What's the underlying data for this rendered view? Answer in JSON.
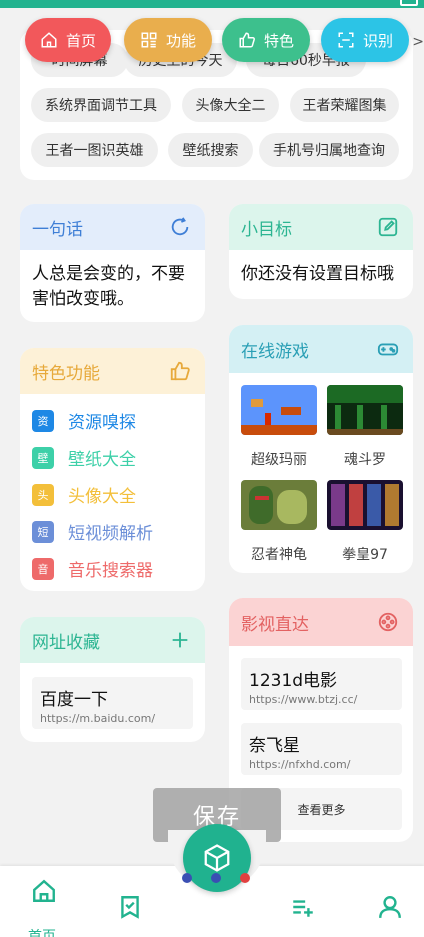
{
  "colors": {
    "accent": "#22b38f",
    "home_pill": "#f2585b",
    "func_pill": "#e9ae4d",
    "feat_pill": "#3dc08d",
    "scan_pill": "#2cc4e6"
  },
  "top_tabs": [
    {
      "label": "首页",
      "icon": "home-icon"
    },
    {
      "label": "功能",
      "icon": "grid-icon"
    },
    {
      "label": "特色",
      "icon": "thumbs-up-icon"
    },
    {
      "label": "识别",
      "icon": "scan-icon"
    }
  ],
  "edge_arrow": ">",
  "tags": {
    "row0": [
      "时间屏幕",
      "历史上的今天",
      "每日60秒早报"
    ],
    "row1": [
      "系统界面调节工具",
      "头像大全二",
      "王者荣耀图集"
    ],
    "row2": [
      "王者一图识英雄",
      "壁纸搜索",
      "手机号归属地查询"
    ]
  },
  "sentence": {
    "title": "一句话",
    "icon": "refresh-icon",
    "text_line1": "人总是会变的，不要",
    "text_line2": "害怕改变哦。"
  },
  "goal": {
    "title": "小目标",
    "icon": "edit-icon",
    "text": "你还没有设置目标哦"
  },
  "features": {
    "title": "特色功能",
    "icon": "thumbs-up-icon",
    "items": [
      {
        "badge": "资",
        "label": "资源嗅探",
        "color": "#1e88e5"
      },
      {
        "badge": "壁",
        "label": "壁纸大全",
        "color": "#3dd0a8"
      },
      {
        "badge": "头",
        "label": "头像大全",
        "color": "#f3bf3a"
      },
      {
        "badge": "短",
        "label": "短视频解析",
        "color": "#6c8fd8"
      },
      {
        "badge": "音",
        "label": "音乐搜索器",
        "color": "#ee6a6a"
      }
    ]
  },
  "games": {
    "title": "在线游戏",
    "icon": "gamepad-icon",
    "items": [
      "超级玛丽",
      "魂斗罗",
      "忍者神龟",
      "拳皇97"
    ]
  },
  "bookmarks": {
    "title": "网址收藏",
    "icon": "plus-icon",
    "items": [
      {
        "title": "百度一下",
        "url": "https://m.baidu.com/"
      }
    ]
  },
  "video": {
    "title": "影视直达",
    "icon": "film-reel-icon",
    "items": [
      {
        "title": "1231d电影",
        "url": "https://www.btzj.cc/"
      },
      {
        "title": "奈飞星",
        "url": "https://nfxhd.com/"
      }
    ],
    "more": "查看更多"
  },
  "toast": "保存",
  "bottom_nav": {
    "home_label": "首页"
  }
}
